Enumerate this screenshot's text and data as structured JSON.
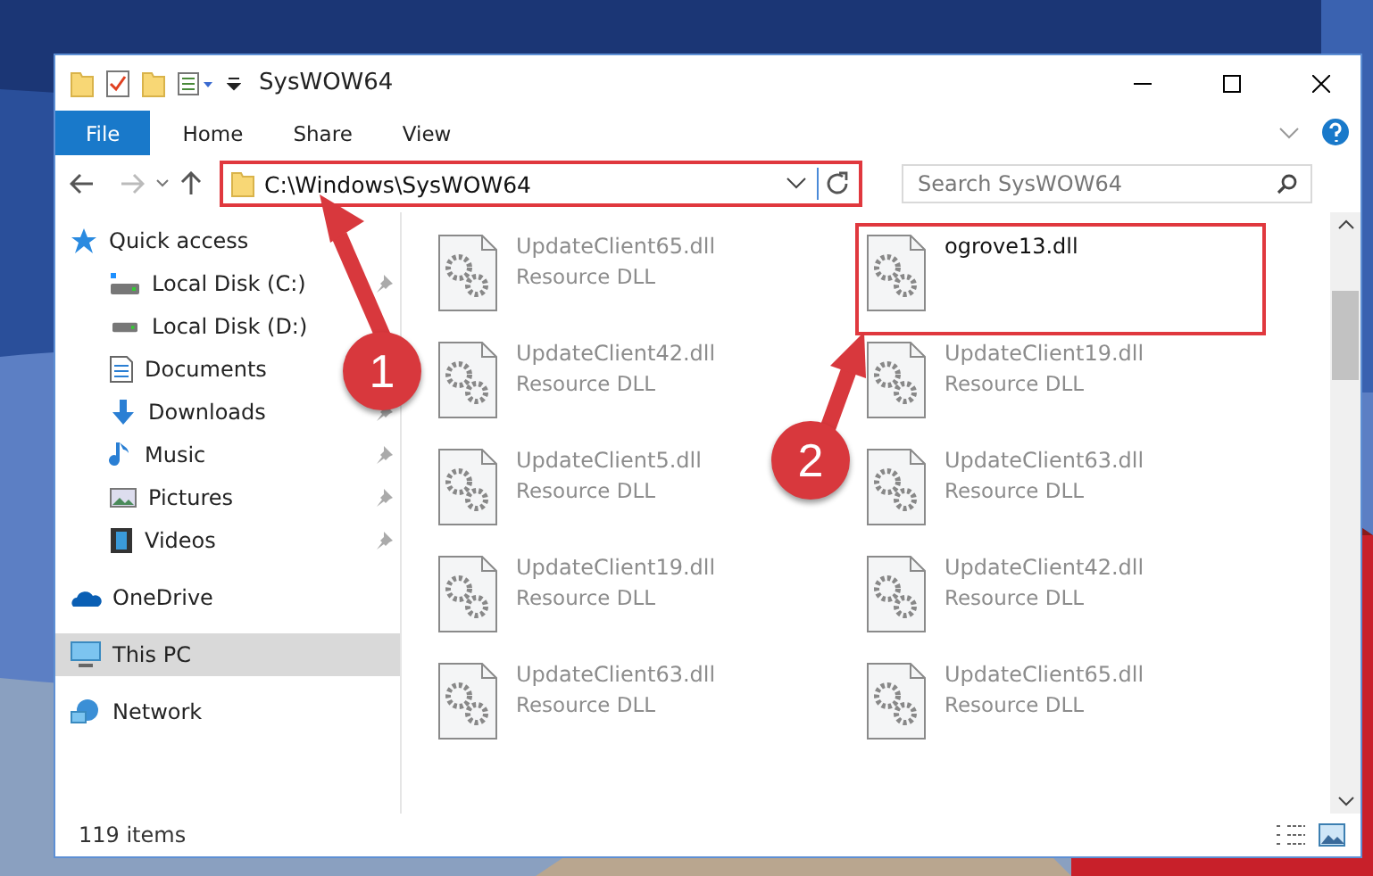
{
  "window": {
    "title": "SysWOW64"
  },
  "ribbon": {
    "tabs": [
      {
        "label": "File",
        "kind": "file"
      },
      {
        "label": "Home",
        "kind": "tab"
      },
      {
        "label": "Share",
        "kind": "tab"
      },
      {
        "label": "View",
        "kind": "tab"
      }
    ]
  },
  "address": {
    "path": "C:\\Windows\\SysWOW64",
    "highlighted": true
  },
  "search": {
    "placeholder": "Search SysWOW64"
  },
  "sidebar": {
    "items": [
      {
        "label": "Quick access",
        "selected": false,
        "children": [
          {
            "label": "Local Disk (C:)",
            "selected": false,
            "pinned": true
          },
          {
            "label": "Local Disk (D:)",
            "selected": false,
            "pinned": false
          },
          {
            "label": "Documents",
            "selected": false,
            "pinned": false
          },
          {
            "label": "Downloads",
            "selected": false,
            "pinned": true
          },
          {
            "label": "Music",
            "selected": false,
            "pinned": true
          },
          {
            "label": "Pictures",
            "selected": false,
            "pinned": true
          },
          {
            "label": "Videos",
            "selected": false,
            "pinned": true
          }
        ]
      },
      {
        "label": "OneDrive",
        "selected": false
      },
      {
        "label": "This PC",
        "selected": true
      },
      {
        "label": "Network",
        "selected": false
      }
    ]
  },
  "files": [
    {
      "name": "UpdateClient65.dll",
      "type": "Resource DLL",
      "blurred": true,
      "highlighted": false
    },
    {
      "name": "ogrove13.dll",
      "blurred": false,
      "highlighted": true
    },
    {
      "name": "UpdateClient42.dll",
      "type": "Resource DLL",
      "blurred": true,
      "highlighted": false
    },
    {
      "name": "UpdateClient19.dll",
      "type": "Resource DLL",
      "blurred": true,
      "highlighted": false
    },
    {
      "name": "UpdateClient5.dll",
      "type": "Resource DLL",
      "blurred": true,
      "highlighted": false
    },
    {
      "name": "UpdateClient63.dll",
      "type": "Resource DLL",
      "blurred": true,
      "highlighted": false
    },
    {
      "name": "UpdateClient19.dll",
      "type": "Resource DLL",
      "blurred": true,
      "highlighted": false
    },
    {
      "name": "UpdateClient42.dll",
      "type": "Resource DLL",
      "blurred": true,
      "highlighted": false
    },
    {
      "name": "UpdateClient63.dll",
      "type": "Resource DLL",
      "blurred": true,
      "highlighted": false
    },
    {
      "name": "UpdateClient65.dll",
      "type": "Resource DLL",
      "blurred": true,
      "highlighted": false
    }
  ],
  "status_bar": {
    "count": "119 items"
  },
  "annotations": [
    {
      "label": "1"
    },
    {
      "label": "2"
    }
  ]
}
